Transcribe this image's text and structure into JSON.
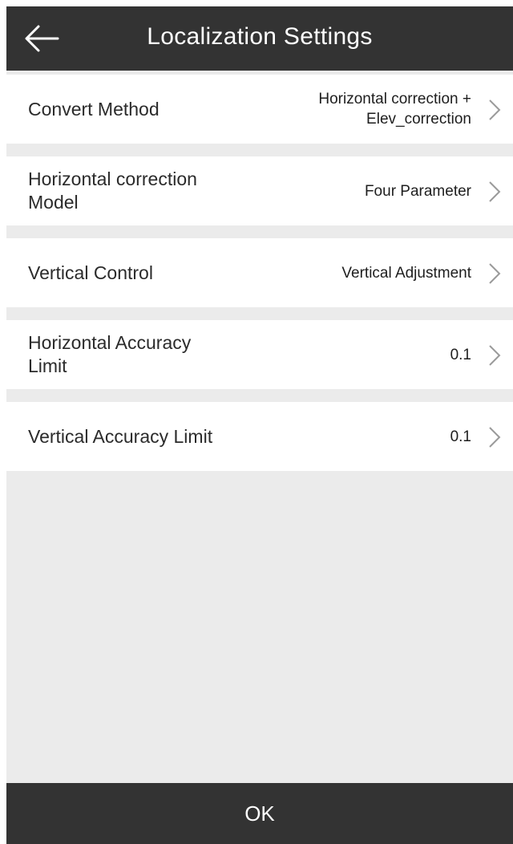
{
  "header": {
    "title": "Localization Settings",
    "back_icon": "arrow-left-icon"
  },
  "settings": [
    {
      "label": "Convert Method",
      "value_line1": "Horizontal correction +",
      "value_line2": "Elev_correction"
    },
    {
      "label": "Horizontal correction Model",
      "value_line1": "Four Parameter",
      "value_line2": ""
    },
    {
      "label": "Vertical Control",
      "value_line1": "Vertical Adjustment",
      "value_line2": ""
    },
    {
      "label": "Horizontal Accuracy Limit",
      "value_line1": "0.1",
      "value_line2": ""
    },
    {
      "label": "Vertical Accuracy Limit",
      "value_line1": "0.1",
      "value_line2": ""
    }
  ],
  "footer": {
    "ok_label": "OK"
  },
  "colors": {
    "bar": "#333333",
    "background": "#ebebeb",
    "row": "#ffffff",
    "chevron": "#9a9a9a"
  }
}
